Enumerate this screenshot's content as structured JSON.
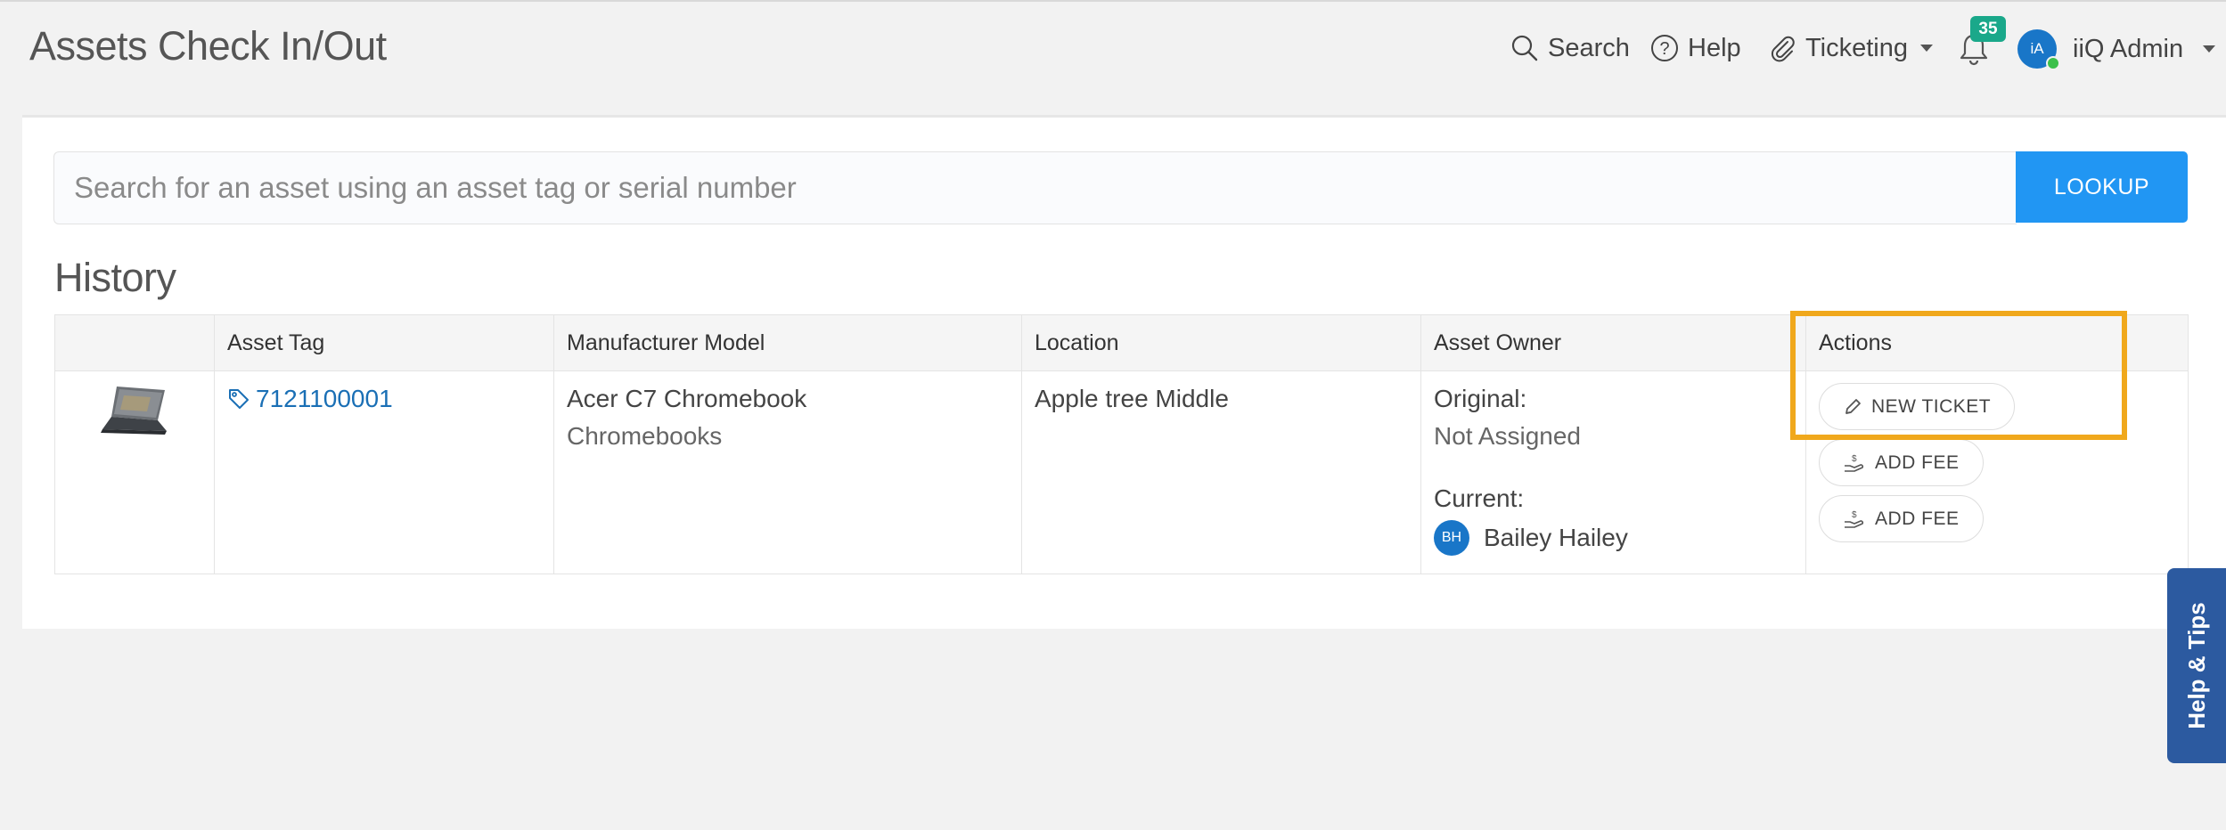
{
  "page": {
    "title": "Assets Check In/Out"
  },
  "nav": {
    "search_label": "Search",
    "help_label": "Help",
    "ticketing_label": "Ticketing",
    "notification_count": "35",
    "user_initials": "iA",
    "user_name": "iiQ Admin"
  },
  "lookup": {
    "placeholder": "Search for an asset using an asset tag or serial number",
    "button_label": "LOOKUP"
  },
  "history": {
    "title": "History",
    "columns": [
      "",
      "Asset Tag",
      "Manufacturer Model",
      "Location",
      "Asset Owner",
      "Actions"
    ],
    "rows": [
      {
        "asset_tag": "7121100001",
        "model": "Acer C7 Chromebook",
        "category": "Chromebooks",
        "location": "Apple tree Middle",
        "original_label": "Original:",
        "original_owner": "Not Assigned",
        "current_label": "Current:",
        "current_initials": "BH",
        "current_owner": "Bailey Hailey",
        "actions": [
          "NEW TICKET",
          "ADD FEE",
          "ADD FEE"
        ]
      }
    ]
  },
  "help_tab": {
    "label": "Help & Tips"
  },
  "colors": {
    "accent": "#2196f3",
    "highlight": "#f0a81c",
    "badge": "#1aa88a",
    "help_tab": "#2c5aa0"
  }
}
